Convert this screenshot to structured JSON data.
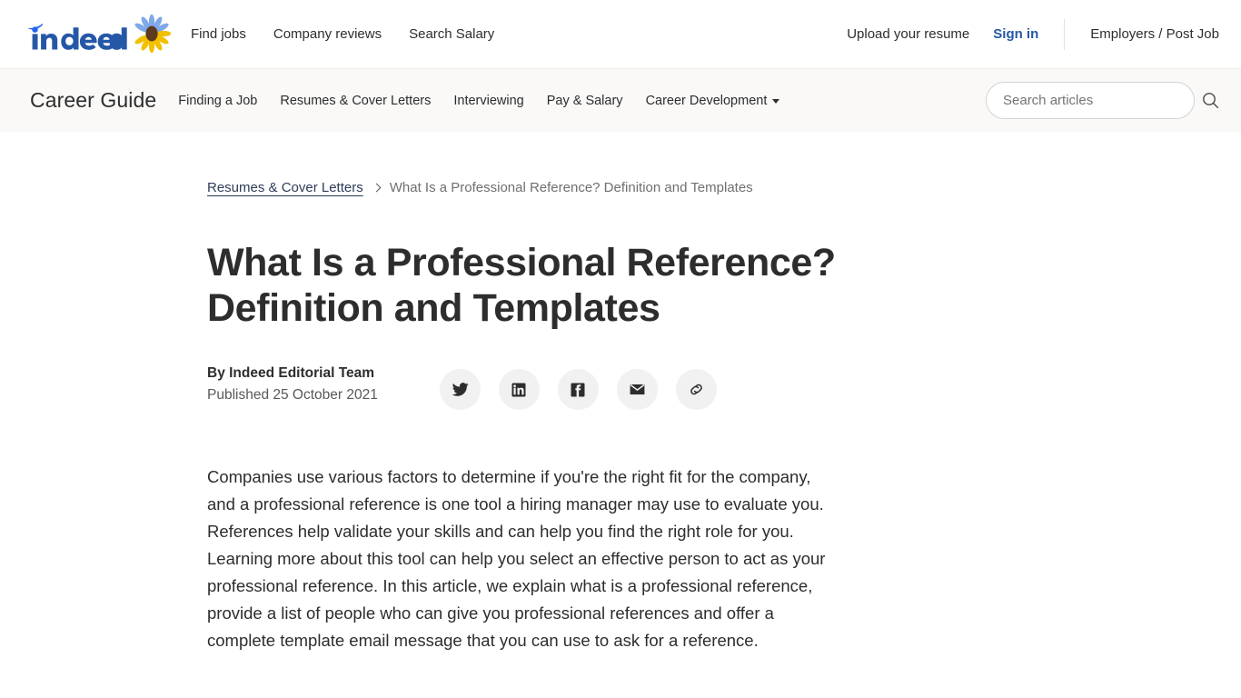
{
  "global_nav": {
    "logo_text": "indeed",
    "logo_icon": "indeed-sunflower-icon",
    "links": [
      {
        "label": "Find jobs",
        "name": "find-jobs"
      },
      {
        "label": "Company reviews",
        "name": "company-reviews"
      },
      {
        "label": "Search Salary",
        "name": "search-salary"
      }
    ],
    "upload_resume": "Upload your resume",
    "sign_in": "Sign in",
    "employers": "Employers / Post Job",
    "sign_in_color": "#2557a7"
  },
  "career_guide_nav": {
    "title": "Career Guide",
    "links": [
      {
        "label": "Finding a Job",
        "name": "finding-a-job",
        "dropdown": false
      },
      {
        "label": "Resumes & Cover Letters",
        "name": "resumes-cover-letters",
        "dropdown": false
      },
      {
        "label": "Interviewing",
        "name": "interviewing",
        "dropdown": false
      },
      {
        "label": "Pay & Salary",
        "name": "pay-salary",
        "dropdown": false
      },
      {
        "label": "Career Development",
        "name": "career-development",
        "dropdown": true
      }
    ],
    "search": {
      "placeholder": "Search articles",
      "value": "",
      "icon": "search-icon"
    },
    "background_color": "#faf9f8"
  },
  "breadcrumb": {
    "parent": "Resumes & Cover Letters",
    "separator": "chevron-right-icon",
    "current": "What Is a Professional Reference? Definition and Templates"
  },
  "article": {
    "headline": "What Is a Professional Reference? Definition and Templates",
    "author": "By Indeed Editorial Team",
    "published": "Published 25 October 2021",
    "share_buttons": [
      {
        "name": "share-twitter-button",
        "icon": "twitter-icon",
        "label": "Twitter"
      },
      {
        "name": "share-linkedin-button",
        "icon": "linkedin-icon",
        "label": "LinkedIn"
      },
      {
        "name": "share-facebook-button",
        "icon": "facebook-icon",
        "label": "Facebook"
      },
      {
        "name": "share-email-button",
        "icon": "email-icon",
        "label": "Email"
      },
      {
        "name": "share-link-button",
        "icon": "link-icon",
        "label": "Copy link"
      }
    ],
    "intro_paragraph": "Companies use various factors to determine if you're the right fit for the company, and a professional reference is one tool a hiring manager may use to evaluate you. References help validate your skills and can help you find the right role for you. Learning more about this tool can help you select an effective person to act as your professional reference. In this article, we explain what is a professional reference, provide a list of people who can give you professional references and offer a complete template email message that you can use to ask for a reference."
  }
}
